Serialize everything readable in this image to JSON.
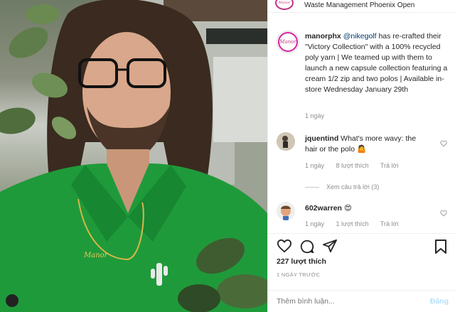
{
  "post": {
    "location": "Waste Management Phoenix Open",
    "header_avatar_text": "Manor",
    "author": "manorphx",
    "caption_mention": "@nikegolf",
    "caption_text": " has re-crafted their \"Victory Collection\" with a 100% recycled poly yarn | We teamed up with them to launch a new capsule collection featuring a cream 1/2 zip and two polos | Available in-store Wednesday January 29th",
    "caption_time": "1 ngày"
  },
  "comments": [
    {
      "user": "jquentind",
      "text": "What's more wavy: the hair or the polo 🤷",
      "time": "1 ngày",
      "likes": "8 lượt thích",
      "reply": "Trả lời",
      "view_replies": "Xem câu trả lời (3)"
    },
    {
      "user": "602warren",
      "text": "😍",
      "time": "1 ngày",
      "likes": "1 lượt thích",
      "reply": "Trả lời"
    }
  ],
  "stats": {
    "likes": "227 lượt thích",
    "date": "1 NGÀY TRƯỚC"
  },
  "add_comment": {
    "placeholder": "Thêm bình luận...",
    "post_label": "Đăng"
  },
  "photo": {
    "necklace_text": "Manor"
  },
  "icons": [
    "heart-icon",
    "comment-icon",
    "share-icon",
    "bookmark-icon"
  ],
  "colors": {
    "shirt_green": "#1f9a3a",
    "brand_ring": "#c13584",
    "post_disabled": "#b2dffc"
  }
}
